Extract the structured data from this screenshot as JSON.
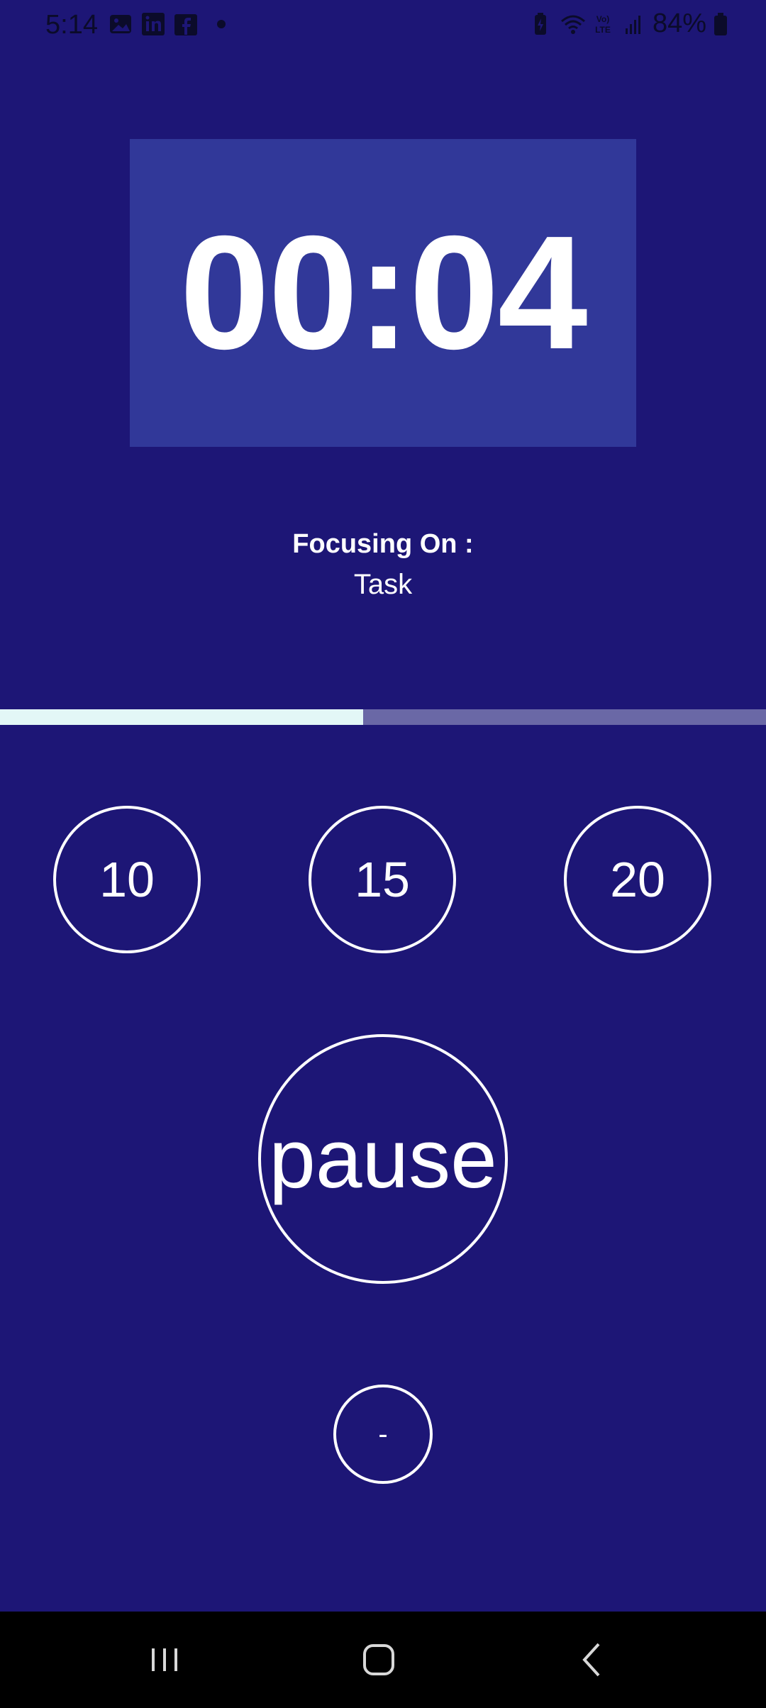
{
  "status_bar": {
    "time": "5:14",
    "battery": "84%",
    "icons": [
      "gallery-icon",
      "linkedin-icon",
      "facebook-icon",
      "notification-dot",
      "battery-saver-icon",
      "wifi-icon",
      "volte-icon",
      "signal-icon",
      "battery-icon"
    ]
  },
  "timer": {
    "display": "00:04"
  },
  "focus": {
    "title": "Focusing On :",
    "task": "Task"
  },
  "progress": {
    "fraction": 0.474
  },
  "presets": [
    {
      "label": "10"
    },
    {
      "label": "15"
    },
    {
      "label": "20"
    }
  ],
  "controls": {
    "pause_label": "pause",
    "minus_label": "-"
  },
  "nav": {
    "buttons": [
      "recent-apps",
      "home",
      "back"
    ]
  },
  "colors": {
    "background": "#1d1676",
    "timer_panel": "#313899",
    "progress_fill": "#e3f7f6",
    "progress_track": "#6a68a6",
    "foreground": "#ffffff"
  }
}
